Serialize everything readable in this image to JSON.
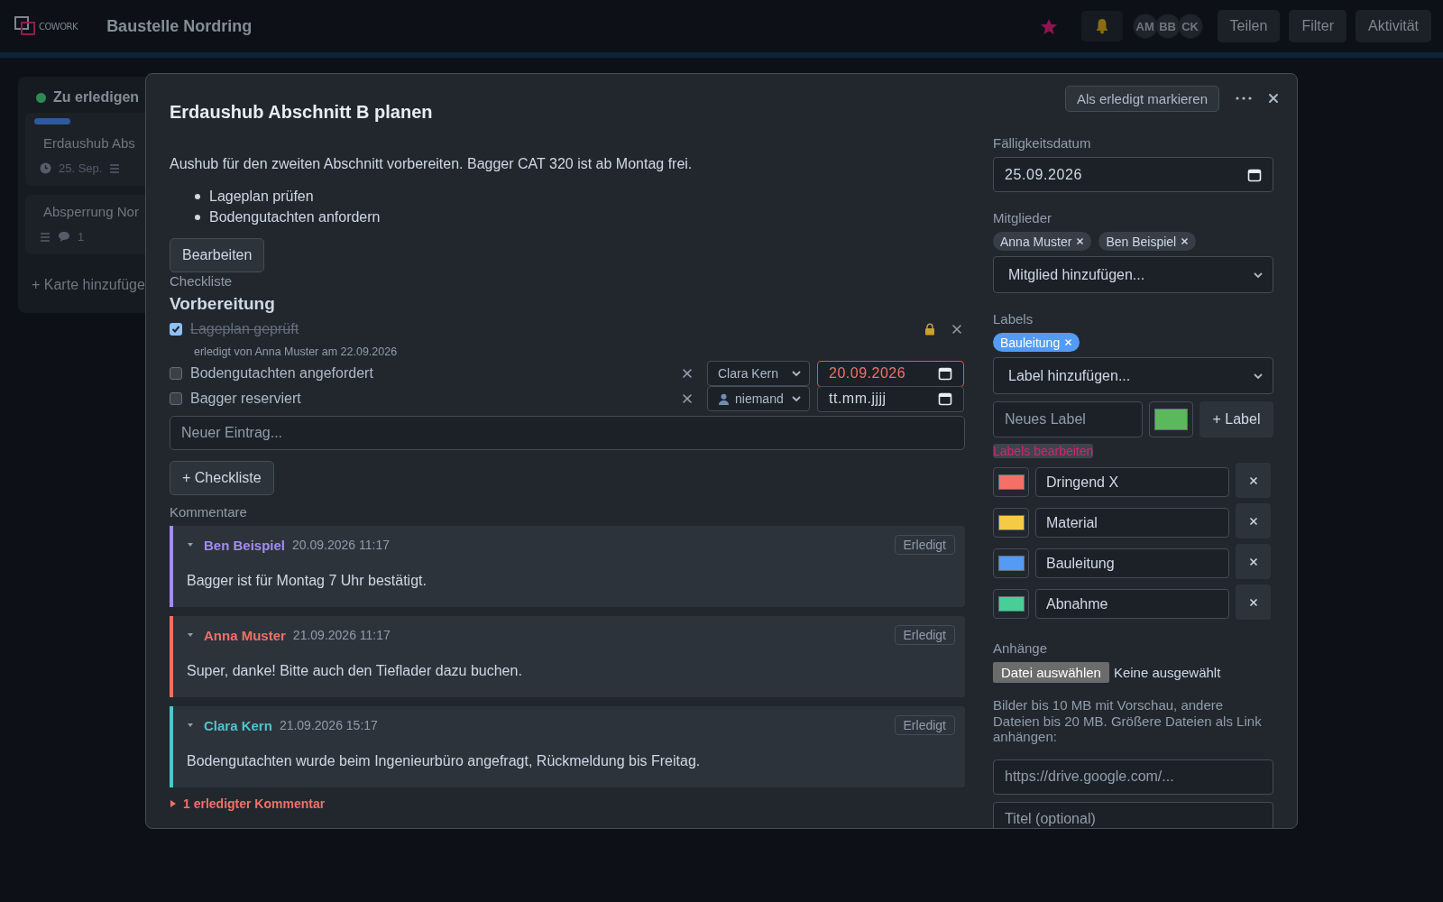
{
  "header": {
    "logo": "COWORK",
    "board_title": "Baustelle Nordring",
    "starred": true,
    "avatars": [
      "AM",
      "BB",
      "CK"
    ],
    "buttons": [
      "Teilen",
      "Filter",
      "Aktivität"
    ]
  },
  "board": {
    "column_title": "Zu erledigen",
    "cards": [
      {
        "title": "Erdaushub Abs",
        "due": "25. Sep."
      },
      {
        "title": "Absperrung Nor",
        "comments": "1"
      }
    ],
    "add_card": "+ Karte hinzufüge"
  },
  "modal": {
    "title": "Erdaushub Abschnitt B planen",
    "mark_done_button": "Als erledigt markieren",
    "description": "Aushub für den zweiten Abschnitt vorbereiten. Bagger CAT 320 ist ab Montag frei.",
    "bullets": [
      "Lageplan prüfen",
      "Bodengutachten anfordern"
    ],
    "edit_button": "Bearbeiten",
    "checklist_heading": "Checkliste",
    "checklists": [
      {
        "title": "Vorbereitung",
        "new_item_placeholder": "Neuer Eintrag...",
        "items": [
          {
            "text": "Lageplan geprüft",
            "checked": true,
            "note": "erledigt von Anna Muster am 22.09.2026"
          },
          {
            "text": "Bodengutachten angefordert",
            "checked": false,
            "assignee": "Clara Kern",
            "due": "20.09.2026",
            "overdue": true
          },
          {
            "text": "Bagger reserviert",
            "checked": false,
            "assignee": "niemand",
            "unassigned": true,
            "due_placeholder": "tt.mm.jjjj",
            "overdue": false
          }
        ]
      }
    ],
    "add_checklist_button": "+ Checkliste",
    "comments_heading": "Kommentare",
    "comments": [
      {
        "author": "Ben Beispiel",
        "color": "#a48cf2",
        "time": "20.09.2026 11:17",
        "text": "Bagger ist für Montag 7 Uhr bestätigt.",
        "button": "Erledigt"
      },
      {
        "author": "Anna Muster",
        "color": "#f47067",
        "time": "21.09.2026 11:17",
        "text": "Super, danke! Bitte auch den Tieflader dazu buchen.",
        "button": "Erledigt"
      },
      {
        "author": "Clara Kern",
        "color": "#4ec5cf",
        "time": "21.09.2026 15:17",
        "text": "Bodengutachten wurde beim Ingenieurbüro angefragt, Rückmeldung bis Freitag.",
        "button": "Erledigt"
      }
    ],
    "resolved_toggle": "1 erledigter Kommentar"
  },
  "side": {
    "due_label": "Fälligkeitsdatum",
    "due": "25.09.2026",
    "members_label": "Mitglieder",
    "members": [
      "Anna Muster",
      "Ben Beispiel"
    ],
    "member_select": "Mitglied hinzufügen...",
    "labels_label": "Labels",
    "labels": [
      {
        "name": "Bauleitung",
        "color": "#539bf5"
      }
    ],
    "label_select": "Label hinzufügen...",
    "new_label_placeholder": "Neues Label",
    "add_label_button": "+ Label",
    "edit_labels_link": "Labels bearbeiten",
    "label_editor": [
      {
        "name": "Dringend X",
        "color": "#f47067"
      },
      {
        "name": "Material",
        "color": "#f5cb46"
      },
      {
        "name": "Bauleitung",
        "color": "#539bf5"
      },
      {
        "name": "Abnahme",
        "color": "#47cf97"
      }
    ],
    "attachments_label": "Anhänge",
    "file_button": "Datei auswählen",
    "file_status": "Keine ausgewählt",
    "attachments_hint": "Bilder bis 10 MB mit Vorschau, andere Dateien bis 20 MB. Größere Dateien als Link anhängen:",
    "link_placeholder": "https://drive.google.com/...",
    "link_title_placeholder": "Titel (optional)"
  }
}
